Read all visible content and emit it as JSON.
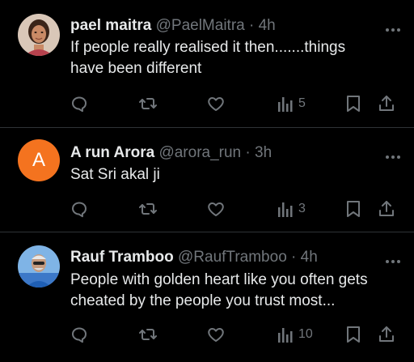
{
  "colors": {
    "background": "#000000",
    "text": "#e7e9ea",
    "muted": "#71767b",
    "divider": "#2f3336",
    "avatar_orange": "#f4731f"
  },
  "tweets": [
    {
      "name": "pael maitra",
      "handle": "@PaelMaitra",
      "dot": "·",
      "time": "4h",
      "text": "If people really realised it then.......things\nhave been different",
      "avatar": "photo",
      "views": "5"
    },
    {
      "name": "A run Arora",
      "handle": "@arora_run",
      "dot": "·",
      "time": "3h",
      "text": "Sat Sri akal ji",
      "avatar": "letter",
      "avatar_letter": "A",
      "views": "3"
    },
    {
      "name": "Rauf Tramboo",
      "handle": "@RaufTramboo",
      "dot": "·",
      "time": "4h",
      "text": "People with golden heart like you often gets\ncheated by the people you trust most...",
      "avatar": "photo",
      "views": "10"
    }
  ],
  "icons": [
    "reply-icon",
    "retweet-icon",
    "like-icon",
    "views-icon",
    "bookmark-icon",
    "share-icon",
    "more-icon"
  ]
}
